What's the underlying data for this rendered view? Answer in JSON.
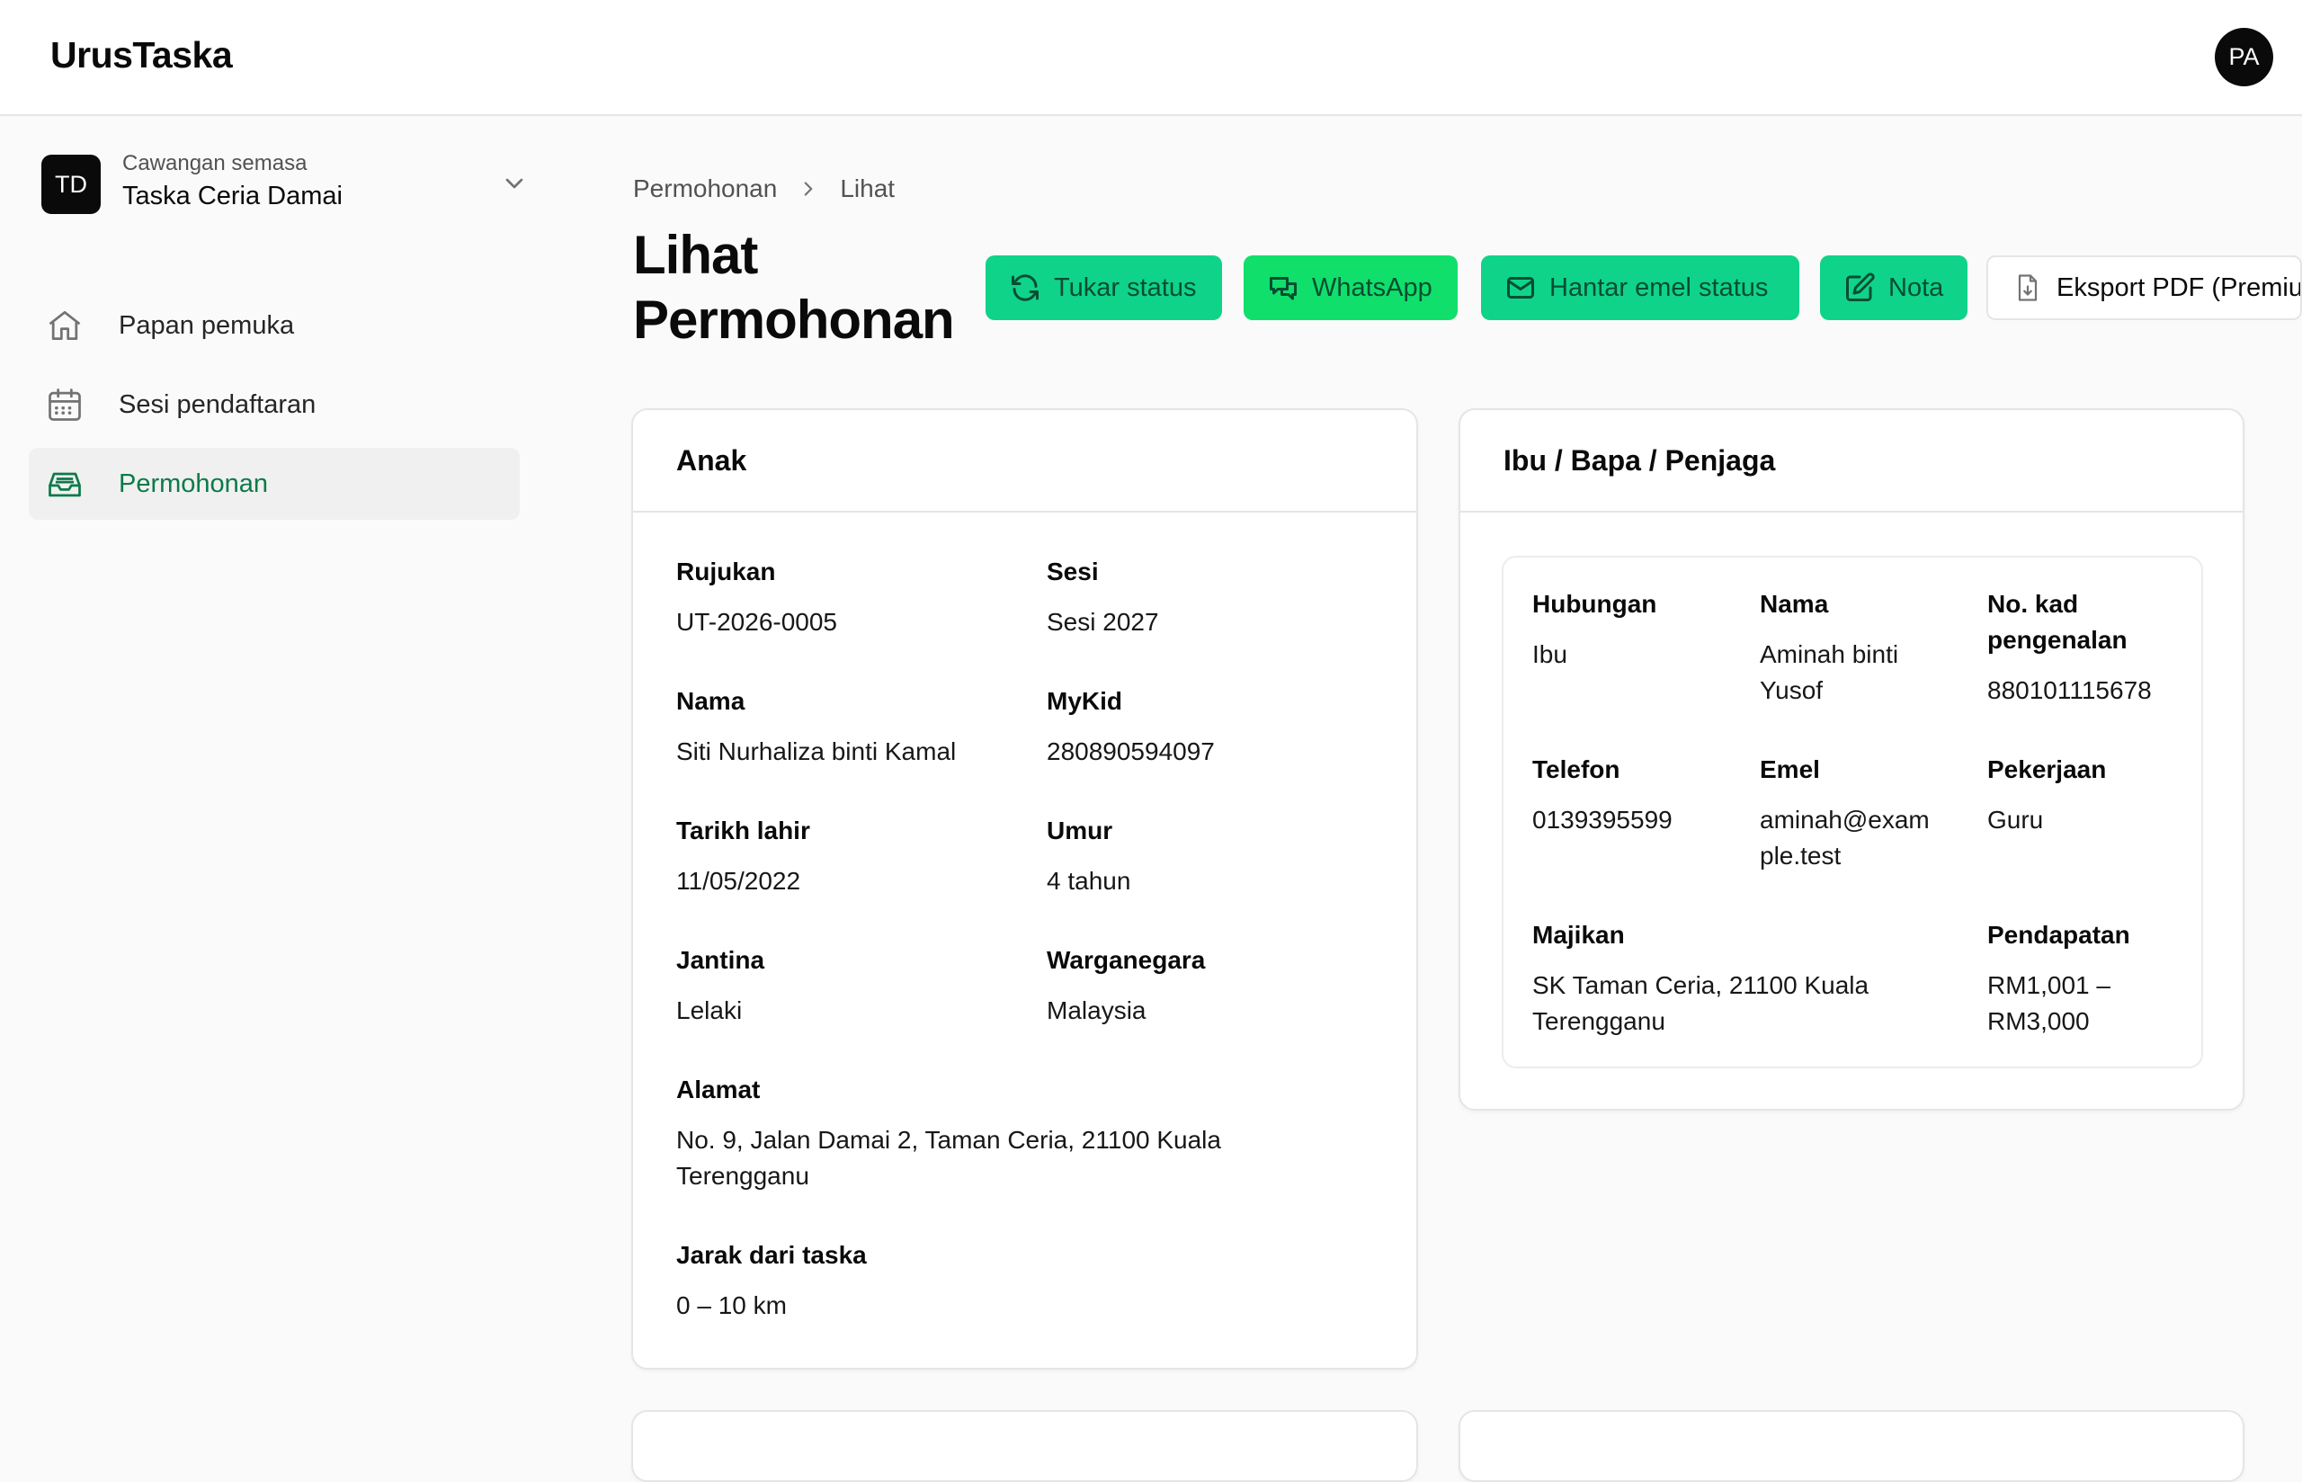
{
  "app": {
    "brand": "UrusTaska",
    "avatar_initials": "PA"
  },
  "branch": {
    "initials": "TD",
    "caption": "Cawangan semasa",
    "name": "Taska Ceria Damai"
  },
  "nav": [
    {
      "label": "Papan pemuka",
      "icon": "home-icon",
      "active": false
    },
    {
      "label": "Sesi pendaftaran",
      "icon": "calendar-icon",
      "active": false
    },
    {
      "label": "Permohonan",
      "icon": "inbox-icon",
      "active": true
    }
  ],
  "breadcrumb": {
    "parent": "Permohonan",
    "current": "Lihat"
  },
  "page": {
    "title": "Lihat Permohonan"
  },
  "actions": {
    "tukar_status": "Tukar status",
    "whatsapp": "WhatsApp",
    "hantar_emel": "Hantar emel status",
    "nota": "Nota",
    "eksport_pdf": "Eksport PDF (Premium)"
  },
  "child": {
    "heading": "Anak",
    "rujukan_label": "Rujukan",
    "rujukan": "UT-2026-0005",
    "sesi_label": "Sesi",
    "sesi": "Sesi 2027",
    "nama_label": "Nama",
    "nama": "Siti Nurhaliza binti Kamal",
    "mykid_label": "MyKid",
    "mykid": "280890594097",
    "tarikh_label": "Tarikh lahir",
    "tarikh": "11/05/2022",
    "umur_label": "Umur",
    "umur": "4 tahun",
    "jantina_label": "Jantina",
    "jantina": "Lelaki",
    "warganegara_label": "Warganegara",
    "warganegara": "Malaysia",
    "alamat_label": "Alamat",
    "alamat_1": "No. 9, Jalan Damai 2, Taman Ceria, 21100 Kuala",
    "alamat_2": "Terengganu",
    "jarak_label": "Jarak dari taska",
    "jarak": "0 – 10 km"
  },
  "guardian": {
    "heading": "Ibu / Bapa / Penjaga",
    "hubungan_label": "Hubungan",
    "hubungan": "Ibu",
    "nama_label": "Nama",
    "nama_1": "Aminah binti",
    "nama_2": "Yusof",
    "ic_label_1": "No. kad",
    "ic_label_2": "pengenalan",
    "ic": "880101115678",
    "telefon_label": "Telefon",
    "telefon": "0139395599",
    "emel_label": "Emel",
    "emel_1": "aminah@exam",
    "emel_2": "ple.test",
    "pekerjaan_label": "Pekerjaan",
    "pekerjaan": "Guru",
    "majikan_label": "Majikan",
    "majikan_1": "SK Taman Ceria, 21100 Kuala",
    "majikan_2": "Terengganu",
    "pendapatan_label": "Pendapatan",
    "pendapatan_1": "RM1,001 –",
    "pendapatan_2": "RM3,000"
  },
  "colors": {
    "accent": "#10d38a",
    "whatsapp": "#11df6b",
    "active_nav_text": "#0b7a49"
  }
}
